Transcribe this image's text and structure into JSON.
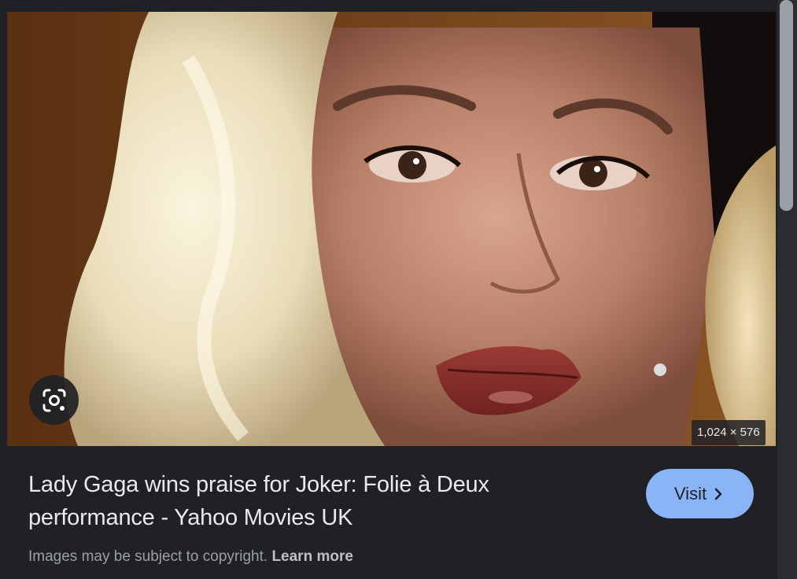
{
  "preview": {
    "image_alt": "Lady Gaga close-up photo",
    "dimensions": "1,024 × 576",
    "lens_icon": "google-lens-icon"
  },
  "result": {
    "title_line1": "Lady Gaga wins praise for Joker: Folie à Deux",
    "title_line2": "performance - Yahoo Movies UK",
    "visit_label": "Visit",
    "visit_icon": "chevron-right-icon",
    "copyright_text": "Images may be subject to copyright.",
    "learn_more_label": "Learn more"
  },
  "colors": {
    "background": "#202124",
    "accent": "#8ab4f8",
    "text_primary": "#e8eaed",
    "text_secondary": "#9aa0a6"
  }
}
